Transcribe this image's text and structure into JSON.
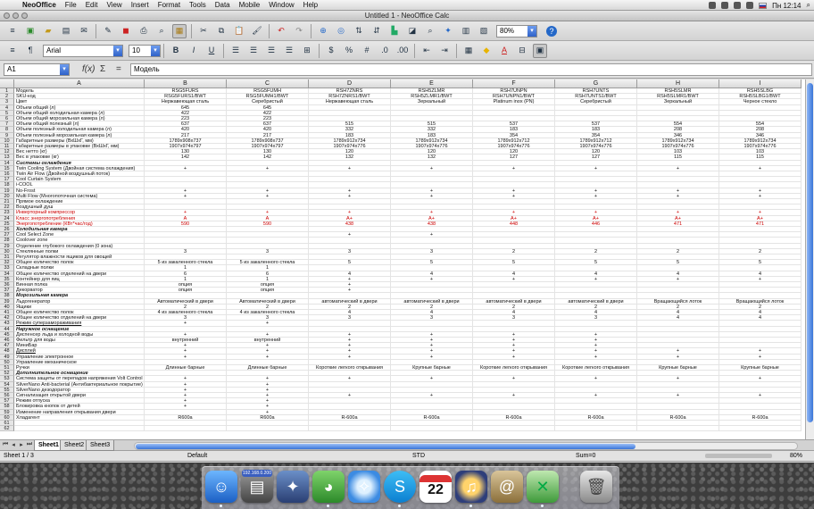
{
  "menubar": {
    "apple": "",
    "items": [
      "NeoOffice",
      "File",
      "Edit",
      "View",
      "Insert",
      "Format",
      "Tools",
      "Data",
      "Mobile",
      "Window",
      "Help"
    ],
    "clock": "Пн 12:14"
  },
  "window": {
    "title": "Untitled 1 - NeoOffice Calc"
  },
  "toolbar": {
    "font_name": "Arial",
    "font_size": "10",
    "zoom": "80%"
  },
  "formula_bar": {
    "cell_ref": "A1",
    "content": "Модель"
  },
  "columns": [
    "A",
    "B",
    "C",
    "D",
    "E",
    "F",
    "G",
    "H",
    "I"
  ],
  "rows": [
    {
      "n": "1",
      "a": "Модель",
      "v": [
        "RSG5FURS",
        "RSG5FUMH",
        "RSH7ZNRS",
        "RSH5ZLMR",
        "RSH7UNPN",
        "RSH7UNTS",
        "RSH5SLMR",
        "RSH5SLBG"
      ]
    },
    {
      "n": "2",
      "a": "SKU-код",
      "v": [
        "RSG5FURS1/BWT",
        "RSG5FUMH1/BWT",
        "RSH7ZNRS1/BWT",
        "RSH5ZLMR1/BWT",
        "RSH7UNPN1/BWT",
        "RSH7UNTS1/BWT",
        "RSH5SLMR1/BWT",
        "RSH5SLBG1/BWT"
      ]
    },
    {
      "n": "3",
      "a": "Цвет",
      "v": [
        "Нержавеющая сталь",
        "Серебристый",
        "Нержавеющая сталь",
        "Зеркальный",
        "Platinum inox (PN)",
        "Серебристый",
        "Зеркальный",
        "Черное стекло"
      ]
    },
    {
      "n": "4",
      "a": "Объем общий (л)",
      "v": [
        "645",
        "645",
        "",
        "",
        "",
        "",
        "",
        ""
      ]
    },
    {
      "n": "5",
      "a": "Объем общий холодильная камера (л)",
      "v": [
        "422",
        "422",
        "",
        "",
        "",
        "",
        "",
        ""
      ]
    },
    {
      "n": "6",
      "a": "Объем общий морозильная камера (л)",
      "v": [
        "223",
        "223",
        "",
        "",
        "",
        "",
        "",
        ""
      ]
    },
    {
      "n": "7",
      "a": "Объем общий полезный (л)",
      "v": [
        "637",
        "637",
        "515",
        "515",
        "537",
        "537",
        "554",
        "554"
      ]
    },
    {
      "n": "8",
      "a": "Объем полезный холодильная камера (л)",
      "v": [
        "420",
        "420",
        "332",
        "332",
        "183",
        "183",
        "208",
        "208"
      ]
    },
    {
      "n": "9",
      "a": "Объем полезный морозильная камера (л)",
      "v": [
        "217",
        "217",
        "183",
        "183",
        "354",
        "354",
        "346",
        "346"
      ]
    },
    {
      "n": "10",
      "a": "Габаритные размеры (ВхШхГ, мм)",
      "v": [
        "1789x908x737",
        "1789x908x737",
        "1789x912x734",
        "1789x912x734",
        "1789x912x712",
        "1789x912x712",
        "1789x912x734",
        "1789x912x734"
      ]
    },
    {
      "n": "11",
      "a": "Габаритные размеры в упаковке (ВхШхГ, мм)",
      "v": [
        "1907x974x797",
        "1907x974x797",
        "1907x974x776",
        "1907x974x776",
        "1907x974x776",
        "1907x974x776",
        "1907x974x776",
        "1907x974x776"
      ]
    },
    {
      "n": "12",
      "a": "Вес нетто (кг)",
      "v": [
        "130",
        "130",
        "120",
        "120",
        "120",
        "120",
        "103",
        "103"
      ]
    },
    {
      "n": "13",
      "a": "Вес в упаковке (кг)",
      "v": [
        "142",
        "142",
        "132",
        "132",
        "127",
        "127",
        "115",
        "115"
      ]
    },
    {
      "n": "14",
      "a": "Системы охлаждения",
      "v": [
        "",
        "",
        "",
        "",
        "",
        "",
        "",
        ""
      ],
      "style": "bold"
    },
    {
      "n": "15",
      "a": "Twin Cooling System (Двойная система охлаждения)",
      "v": [
        "+",
        "+",
        "+",
        "+",
        "+",
        "+",
        "+",
        "+"
      ],
      "style": "u"
    },
    {
      "n": "16",
      "a": "Twin Air Flow (Двойной воздушный поток)",
      "v": [
        "",
        "",
        "",
        "",
        "",
        "",
        "",
        ""
      ],
      "style": "u"
    },
    {
      "n": "17",
      "a": "Cool Curtain System",
      "v": [
        "",
        "",
        "",
        "",
        "",
        "",
        "",
        ""
      ],
      "style": "u"
    },
    {
      "n": "18",
      "a": "i-COOL",
      "v": [
        "",
        "",
        "",
        "",
        "",
        "",
        "",
        ""
      ]
    },
    {
      "n": "19",
      "a": "No-Frost",
      "v": [
        "+",
        "+",
        "+",
        "+",
        "+",
        "+",
        "+",
        "+"
      ],
      "style": "u"
    },
    {
      "n": "20",
      "a": "Multi Flow (Многопоточная система)",
      "v": [
        "+",
        "+",
        "+",
        "+",
        "+",
        "+",
        "+",
        "+"
      ],
      "style": "u"
    },
    {
      "n": "21",
      "a": "Прямое охлаждение",
      "v": [
        "",
        "",
        "",
        "",
        "",
        "",
        "",
        ""
      ]
    },
    {
      "n": "22",
      "a": "Воздушный душ",
      "v": [
        "",
        "",
        "",
        "",
        "",
        "",
        "",
        ""
      ]
    },
    {
      "n": "23",
      "a": "Инверторный компрессор",
      "v": [
        "+",
        "+",
        "+",
        "+",
        "+",
        "+",
        "+",
        "+"
      ],
      "style": "red"
    },
    {
      "n": "24",
      "a": "Класс энергопотребления",
      "v": [
        "A",
        "A",
        "A+",
        "A+",
        "A+",
        "A+",
        "A+",
        "A+"
      ],
      "style": "red"
    },
    {
      "n": "25",
      "a": "Энергопотребление (КВт*час/год)",
      "v": [
        "590",
        "590",
        "438",
        "438",
        "448",
        "446",
        "471",
        "471"
      ],
      "style": "red"
    },
    {
      "n": "26",
      "a": "Холодильная камера",
      "v": [
        "",
        "",
        "",
        "",
        "",
        "",
        "",
        ""
      ],
      "style": "bold"
    },
    {
      "n": "27",
      "a": "Cool Select Zone",
      "v": [
        "",
        "",
        "+",
        "+",
        "",
        "",
        "",
        ""
      ],
      "style": "u"
    },
    {
      "n": "28",
      "a": "Coolover zone",
      "v": [
        "",
        "",
        "",
        "",
        "",
        "",
        "",
        ""
      ]
    },
    {
      "n": "29",
      "a": "Отделение глубокого охлаждения (0 зона)",
      "v": [
        "",
        "",
        "",
        "",
        "",
        "",
        "",
        ""
      ]
    },
    {
      "n": "30",
      "a": "Стеклянные полки",
      "v": [
        "3",
        "3",
        "3",
        "3",
        "2",
        "2",
        "2",
        "2"
      ]
    },
    {
      "n": "31",
      "a": "Регулятор влажности ящиков для овощей",
      "v": [
        "",
        "",
        "",
        "",
        "",
        "",
        "",
        ""
      ]
    },
    {
      "n": "32",
      "a": "Общее количество полок",
      "v": [
        "5 из закаленного стекла",
        "5 из закаленного стекла",
        "5",
        "5",
        "5",
        "5",
        "5",
        "5"
      ]
    },
    {
      "n": "33",
      "a": "Складные полки",
      "v": [
        "1",
        "1",
        "",
        "",
        "",
        "",
        "",
        ""
      ]
    },
    {
      "n": "34",
      "a": "Общее количество отделений на двери",
      "v": [
        "6",
        "6",
        "4",
        "4",
        "4",
        "4",
        "4",
        "4"
      ]
    },
    {
      "n": "35",
      "a": "Контейнер для яиц",
      "v": [
        "1",
        "1",
        "+",
        "+",
        "+",
        "+",
        "+",
        "+"
      ]
    },
    {
      "n": "36",
      "a": "Винная полка",
      "v": [
        "опция",
        "опция",
        "+",
        "",
        "",
        "",
        "",
        ""
      ]
    },
    {
      "n": "37",
      "a": "Декорватор",
      "v": [
        "опция",
        "опция",
        "+",
        "",
        "",
        "",
        "",
        ""
      ],
      "style": "u"
    },
    {
      "n": "38",
      "a": "Морозильная камера",
      "v": [
        "",
        "",
        "",
        "",
        "",
        "",
        "",
        ""
      ],
      "style": "bold"
    },
    {
      "n": "39",
      "a": "Льдогенератор",
      "v": [
        "Автоматический в двери",
        "Автоматический в двери",
        "автоматический в двери",
        "автоматический в двери",
        "автоматический в двери",
        "автоматический в двери",
        "Вращающийся лоток",
        "Вращающийся лоток"
      ],
      "style": "u"
    },
    {
      "n": "40",
      "a": "Ящики",
      "v": [
        "2",
        "2",
        "2",
        "2",
        "2",
        "2",
        "2",
        "2"
      ]
    },
    {
      "n": "41",
      "a": "Общее количество полок",
      "v": [
        "4 из закаленного стекла",
        "4 из закаленного стекла",
        "4",
        "4",
        "4",
        "4",
        "4",
        "4"
      ]
    },
    {
      "n": "42",
      "a": "Общее количество отделений на двери",
      "v": [
        "3",
        "3",
        "3",
        "3",
        "3",
        "3",
        "4",
        "4"
      ]
    },
    {
      "n": "43",
      "a": "Режим суперзамораживания",
      "v": [
        "+",
        "+",
        "",
        "",
        "",
        "",
        "",
        ""
      ],
      "style": "u"
    },
    {
      "n": "44",
      "a": "Наружное оснащение",
      "v": [
        "",
        "",
        "",
        "",
        "",
        "",
        "",
        ""
      ],
      "style": "bold"
    },
    {
      "n": "45",
      "a": "Диспенсер льда и холодной воды",
      "v": [
        "+",
        "+",
        "+",
        "+",
        "+",
        "+",
        "",
        ""
      ],
      "style": "u"
    },
    {
      "n": "46",
      "a": "Фильтр для воды",
      "v": [
        "внутренний",
        "внутренний",
        "+",
        "+",
        "+",
        "+",
        "",
        ""
      ]
    },
    {
      "n": "47",
      "a": "МиниБар",
      "v": [
        "+",
        "+",
        "+",
        "+",
        "+",
        "+",
        "",
        ""
      ],
      "style": "u"
    },
    {
      "n": "48",
      "a": "Дисплей",
      "v": [
        "+",
        "+",
        "+",
        "+",
        "+",
        "+",
        "+",
        "+"
      ],
      "style": "u"
    },
    {
      "n": "49",
      "a": "Управление электронное",
      "v": [
        "+",
        "+",
        "+",
        "+",
        "+",
        "+",
        "+",
        "+"
      ]
    },
    {
      "n": "50",
      "a": "Управление механическое",
      "v": [
        "",
        "",
        "",
        "",
        "",
        "",
        "",
        ""
      ]
    },
    {
      "n": "51",
      "a": "Ручки",
      "v": [
        "Длинные барные",
        "Длинные барные",
        "Короткие легкого открывания",
        "Крупные барные",
        "Короткие легкого открывания",
        "Короткие легкого открывания",
        "Крупные барные",
        "Крупные барные"
      ]
    },
    {
      "n": "52",
      "a": "Дополнительное оснащение",
      "v": [
        "",
        "",
        "",
        "",
        "",
        "",
        "",
        ""
      ],
      "style": "bold"
    },
    {
      "n": "53",
      "a": "Система защиты от перепадов напряжения Volt Control",
      "v": [
        "+",
        "+",
        "+",
        "+",
        "+",
        "+",
        "+",
        "+"
      ]
    },
    {
      "n": "54",
      "a": "SilverNano Anti-bacterial (Антибактериальное покрытие)",
      "v": [
        "+",
        "+",
        "",
        "",
        "",
        "",
        "",
        ""
      ],
      "style": "u"
    },
    {
      "n": "55",
      "a": "SilverNano дезодоратор",
      "v": [
        "+",
        "+",
        "",
        "",
        "",
        "",
        "",
        ""
      ],
      "style": "u"
    },
    {
      "n": "56",
      "a": "Сигнализация открытой двери",
      "v": [
        "+",
        "+",
        "+",
        "+",
        "+",
        "+",
        "+",
        "+"
      ]
    },
    {
      "n": "57",
      "a": "Режим отпуска",
      "v": [
        "+",
        "+",
        "",
        "",
        "",
        "",
        "",
        ""
      ]
    },
    {
      "n": "58",
      "a": "Блокировка кнопок от детей",
      "v": [
        "+",
        "+",
        "",
        "",
        "",
        "",
        "",
        ""
      ]
    },
    {
      "n": "59",
      "a": "Изменение направления открывания двери",
      "v": [
        "",
        "+",
        "",
        "",
        "",
        "",
        "",
        ""
      ]
    },
    {
      "n": "60",
      "a": "Хладагент",
      "v": [
        "R600a",
        "R600a",
        "R-600a",
        "R-600a",
        "R-600a",
        "R-600a",
        "R-600a",
        "R-600a"
      ]
    },
    {
      "n": "61",
      "a": "",
      "v": [
        "",
        "",
        "",
        "",
        "",
        "",
        "",
        ""
      ]
    },
    {
      "n": "62",
      "a": "",
      "v": [
        "",
        "",
        "",
        "",
        "",
        "",
        "",
        ""
      ]
    }
  ],
  "sheets": [
    "Sheet1",
    "Sheet2",
    "Sheet3"
  ],
  "statusbar": {
    "sheet": "Sheet 1 / 3",
    "style": "Default",
    "mode": "STD",
    "sum": "Sum=0",
    "zoom": "80%"
  },
  "dock": {
    "badge": "192.168.0.200",
    "calendar_day": "22"
  }
}
